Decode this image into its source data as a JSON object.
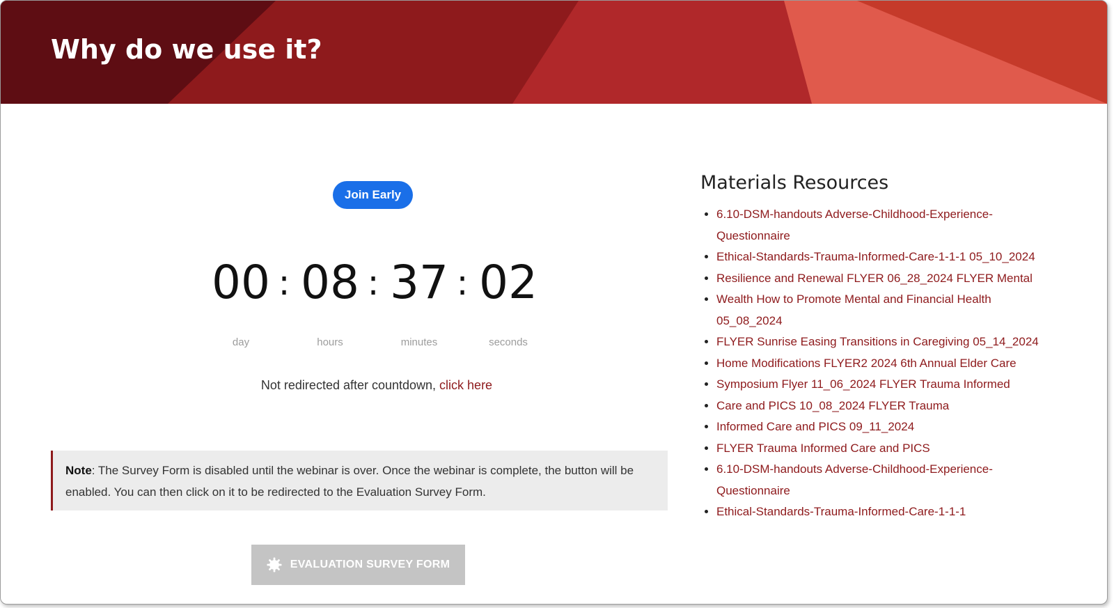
{
  "banner": {
    "title": "Why do we use it?",
    "colors": [
      "#5e0d13",
      "#8e1a1c",
      "#b0282a",
      "#e05a4c",
      "#c53a2a"
    ]
  },
  "join_early": {
    "label": "Join Early",
    "color": "#1a6fe8"
  },
  "countdown": {
    "values": {
      "day": "00",
      "hours": "08",
      "minutes": "37",
      "seconds": "02"
    },
    "labels": {
      "day": "day",
      "hours": "hours",
      "minutes": "minutes",
      "seconds": "seconds"
    },
    "separator": ":"
  },
  "redirect": {
    "text": "Not redirected after countdown, ",
    "link": "click here"
  },
  "note": {
    "label": "Note",
    "text": ": The Survey Form is disabled until the webinar is over. Once the webinar is complete, the button will be enabled. You can then click on it to be redirected to the Evaluation Survey Form."
  },
  "eval_button": {
    "label": "EVALUATION SURVEY FORM",
    "icon": "gear-icon",
    "state": "disabled"
  },
  "resources": {
    "title": "Materials Resources",
    "items": [
      "6.10-DSM-handouts Adverse-Childhood-Experience-Questionnaire",
      "Ethical-Standards-Trauma-Informed-Care-1-1-1 05_10_2024",
      "Resilience and Renewal FLYER 06_28_2024 FLYER Mental",
      "Wealth How to Promote Mental and Financial Health 05_08_2024",
      "FLYER Sunrise Easing Transitions in Caregiving 05_14_2024",
      "Home Modifications FLYER2 2024 6th Annual Elder Care",
      "Symposium Flyer 11_06_2024 FLYER Trauma Informed",
      "Care and PICS 10_08_2024 FLYER Trauma",
      "Informed Care and PICS 09_11_2024",
      "FLYER Trauma Informed Care and PICS",
      "6.10-DSM-handouts Adverse-Childhood-Experience-Questionnaire",
      "Ethical-Standards-Trauma-Informed-Care-1-1-1"
    ],
    "link_color": "#8e1a1c"
  }
}
